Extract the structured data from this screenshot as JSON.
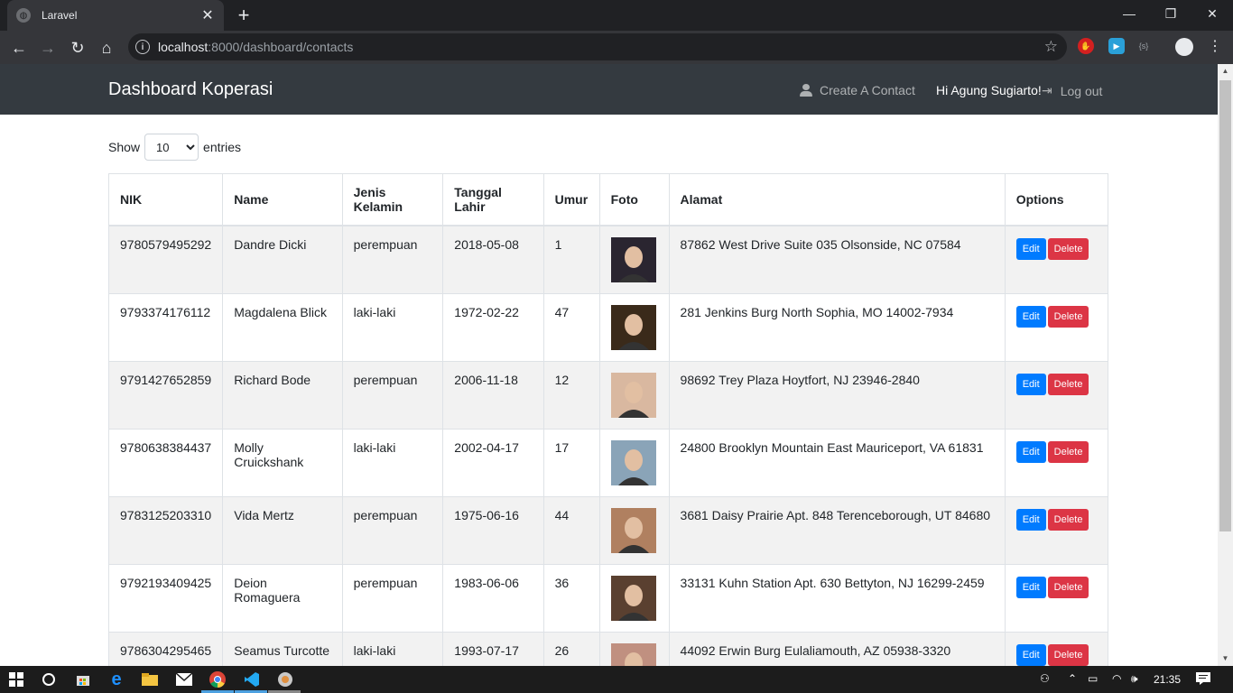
{
  "browser": {
    "tab_title": "Laravel",
    "url_host": "localhost",
    "url_path": ":8000/dashboard/contacts"
  },
  "navbar": {
    "brand": "Dashboard Koperasi",
    "create": "Create A Contact",
    "greeting": "Hi Agung Sugiarto!",
    "logout": "Log out"
  },
  "table_controls": {
    "show": "Show",
    "entries": "entries",
    "page_length": "10"
  },
  "table": {
    "headers": [
      "NIK",
      "Name",
      "Jenis Kelamin",
      "Tanggal Lahir",
      "Umur",
      "Foto",
      "Alamat",
      "Options"
    ],
    "rows": [
      {
        "nik": "9780579495292",
        "name": "Dandre Dicki",
        "gender": "perempuan",
        "dob": "2018-05-08",
        "age": "1",
        "address": "87862 West Drive Suite 035 Olsonside, NC 07584",
        "photo_color": "#2a2530"
      },
      {
        "nik": "9793374176112",
        "name": "Magdalena Blick",
        "gender": "laki-laki",
        "dob": "1972-02-22",
        "age": "47",
        "address": "281 Jenkins Burg North Sophia, MO 14002-7934",
        "photo_color": "#3a2a1a"
      },
      {
        "nik": "9791427652859",
        "name": "Richard Bode",
        "gender": "perempuan",
        "dob": "2006-11-18",
        "age": "12",
        "address": "98692 Trey Plaza Hoytfort, NJ 23946-2840",
        "photo_color": "#d9b8a0"
      },
      {
        "nik": "9780638384437",
        "name": "Molly Cruickshank",
        "gender": "laki-laki",
        "dob": "2002-04-17",
        "age": "17",
        "address": "24800 Brooklyn Mountain East Mauriceport, VA 61831",
        "photo_color": "#8aa4b8"
      },
      {
        "nik": "9783125203310",
        "name": "Vida Mertz",
        "gender": "perempuan",
        "dob": "1975-06-16",
        "age": "44",
        "address": "3681 Daisy Prairie Apt. 848 Terenceborough, UT 84680",
        "photo_color": "#b08060"
      },
      {
        "nik": "9792193409425",
        "name": "Deion Romaguera",
        "gender": "perempuan",
        "dob": "1983-06-06",
        "age": "36",
        "address": "33131 Kuhn Station Apt. 630 Bettyton, NJ 16299-2459",
        "photo_color": "#5a4030"
      },
      {
        "nik": "9786304295465",
        "name": "Seamus Turcotte",
        "gender": "laki-laki",
        "dob": "1993-07-17",
        "age": "26",
        "address": "44092 Erwin Burg Eulaliamouth, AZ 05938-3320",
        "photo_color": "#c09080"
      }
    ],
    "edit_label": "Edit",
    "delete_label": "Delete"
  },
  "taskbar": {
    "time": "21:35"
  },
  "colors": {
    "navbar": "#343a40",
    "edit": "#007bff",
    "delete": "#dc3545"
  }
}
